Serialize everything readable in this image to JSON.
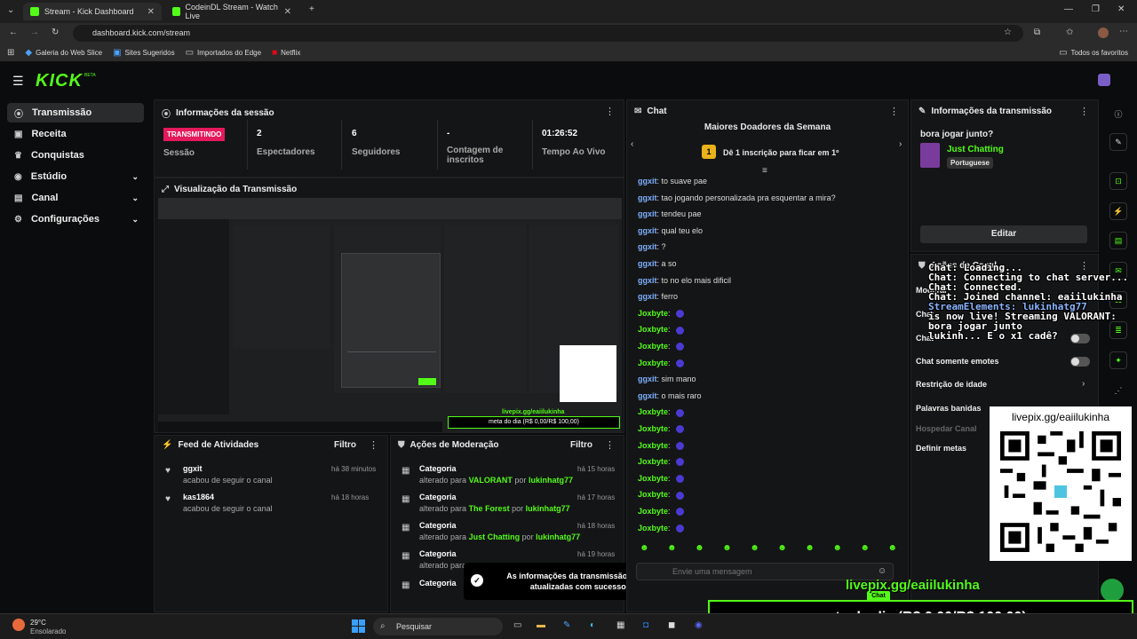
{
  "browser": {
    "tabs": [
      {
        "title": "Stream - Kick Dashboard"
      },
      {
        "title": "CodeinDL Stream - Watch Live"
      }
    ],
    "url": "dashboard.kick.com/stream",
    "bookmarks": [
      "Galeria do Web Slice",
      "Sites Sugeridos",
      "Importados do Edge",
      "Netflix"
    ],
    "all_favorites": "Todos os favoritos"
  },
  "app": {
    "logo": "KICK",
    "beta": "BETA"
  },
  "sidebar": {
    "items": [
      {
        "label": "Transmissão",
        "icon": "radio-icon"
      },
      {
        "label": "Receita",
        "icon": "wallet-icon"
      },
      {
        "label": "Conquistas",
        "icon": "trophy-icon"
      },
      {
        "label": "Estúdio",
        "icon": "studio-icon"
      },
      {
        "label": "Canal",
        "icon": "channel-icon"
      },
      {
        "label": "Configurações",
        "icon": "gear-icon"
      }
    ]
  },
  "session": {
    "title": "Informações da sessão",
    "live_badge": "TRANSMITINDO",
    "session_label": "Sessão",
    "stats": [
      {
        "value": "2",
        "label": "Espectadores"
      },
      {
        "value": "6",
        "label": "Seguidores"
      },
      {
        "value": "-",
        "label": "Contagem de inscritos"
      },
      {
        "value": "01:26:52",
        "label": "Tempo Ao Vivo"
      }
    ]
  },
  "preview": {
    "title": "Visualização da Transmissão",
    "overlay_link": "livepix.gg/eaiilukinha",
    "overlay_goal": "meta do dia (R$ 0,00/R$ 100,00)"
  },
  "activity": {
    "title": "Feed de Atividades",
    "filter": "Filtro",
    "items": [
      {
        "user": "ggxit",
        "action": "acabou de seguir o canal",
        "time": "há 38 minutos"
      },
      {
        "user": "kas1864",
        "action": "acabou de seguir o canal",
        "time": "há 18 horas"
      }
    ]
  },
  "moderation": {
    "title": "Ações de Moderação",
    "filter": "Filtro",
    "items": [
      {
        "type": "Categoria",
        "prefix": "alterado para",
        "category": "VALORANT",
        "by": "por",
        "user": "lukinhatg77",
        "time": "há 15 horas"
      },
      {
        "type": "Categoria",
        "prefix": "alterado para",
        "category": "The Forest",
        "by": "por",
        "user": "lukinhatg77",
        "time": "há 17 horas"
      },
      {
        "type": "Categoria",
        "prefix": "alterado para",
        "category": "Just Chatting",
        "by": "por",
        "user": "lukinhatg77",
        "time": "há 18 horas"
      },
      {
        "type": "Categoria",
        "prefix": "alterado para",
        "category": "",
        "by": "",
        "user": "",
        "time": "há 19 horas"
      },
      {
        "type": "Categoria",
        "prefix": "",
        "category": "",
        "by": "",
        "user": "",
        "time": ""
      }
    ]
  },
  "toast": {
    "message": "As informações da transmissão foram atualizadas com sucesso."
  },
  "chat": {
    "title": "Chat",
    "top_donors": "Maiores Doadores da Semana",
    "sub_prompt": "Dê 1 inscrição para ficar em 1º",
    "rank": "1",
    "input_placeholder": "Envie uma mensagem",
    "send_label": "Chat",
    "messages": [
      {
        "user": "ggxit",
        "text": "to suave pae"
      },
      {
        "user": "ggxit",
        "text": "tao jogando personalizada pra esquentar a mira?"
      },
      {
        "user": "ggxit",
        "text": "tendeu pae"
      },
      {
        "user": "ggxit",
        "text": "qual teu elo"
      },
      {
        "user": "ggxit",
        "text": "?"
      },
      {
        "user": "ggxit",
        "text": "a so"
      },
      {
        "user": "ggxit",
        "text": "to no elo mais dificil"
      },
      {
        "user": "ggxit",
        "text": "ferro"
      },
      {
        "user": "Joxbyte",
        "text": ""
      },
      {
        "user": "Joxbyte",
        "text": ""
      },
      {
        "user": "Joxbyte",
        "text": ""
      },
      {
        "user": "Joxbyte",
        "text": ""
      },
      {
        "user": "ggxit",
        "text": "sim mano"
      },
      {
        "user": "ggxit",
        "text": "o mais raro"
      },
      {
        "user": "Joxbyte",
        "text": ""
      },
      {
        "user": "Joxbyte",
        "text": ""
      },
      {
        "user": "Joxbyte",
        "text": ""
      },
      {
        "user": "Joxbyte",
        "text": ""
      },
      {
        "user": "Joxbyte",
        "text": ""
      },
      {
        "user": "Joxbyte",
        "text": ""
      },
      {
        "user": "Joxbyte",
        "text": ""
      },
      {
        "user": "Joxbyte",
        "text": ""
      }
    ]
  },
  "stream_info": {
    "title": "Informações da transmissão",
    "stream_title": "bora jogar junto?",
    "category": "Just Chatting",
    "language": "Portuguese",
    "edit_button": "Editar"
  },
  "channel_actions": {
    "title": "Ações de Canal",
    "settings": [
      "Moderar",
      "Chat",
      "Chat",
      "Chat somente emotes",
      "Restrição de idade",
      "Palavras banidas",
      "Hospedar Canal",
      "Definir metas"
    ]
  },
  "overlay": {
    "log_lines": [
      "Chat: Loading...",
      "Chat: Connecting to chat server...",
      "Chat: Connected.",
      "Chat: Joined channel: eaiilukinha",
      "StreamElements: lukinhatg77",
      "is now live! Streaming VALORANT:",
      "bora jogar junto",
      "lukinh... E o x1 cadê?"
    ],
    "qr_link": "livepix.gg/eaiilukinha",
    "link_big": "livepix.gg/eaiilukinha",
    "goal": "meta do dia (R$ 0,00/R$ 100,00)"
  },
  "taskbar": {
    "weather_temp": "29°C",
    "weather_desc": "Ensolarado",
    "search": "Pesquisar"
  },
  "colors": {
    "accent": "#53fc18",
    "live": "#e5195b",
    "panel": "#141516"
  }
}
